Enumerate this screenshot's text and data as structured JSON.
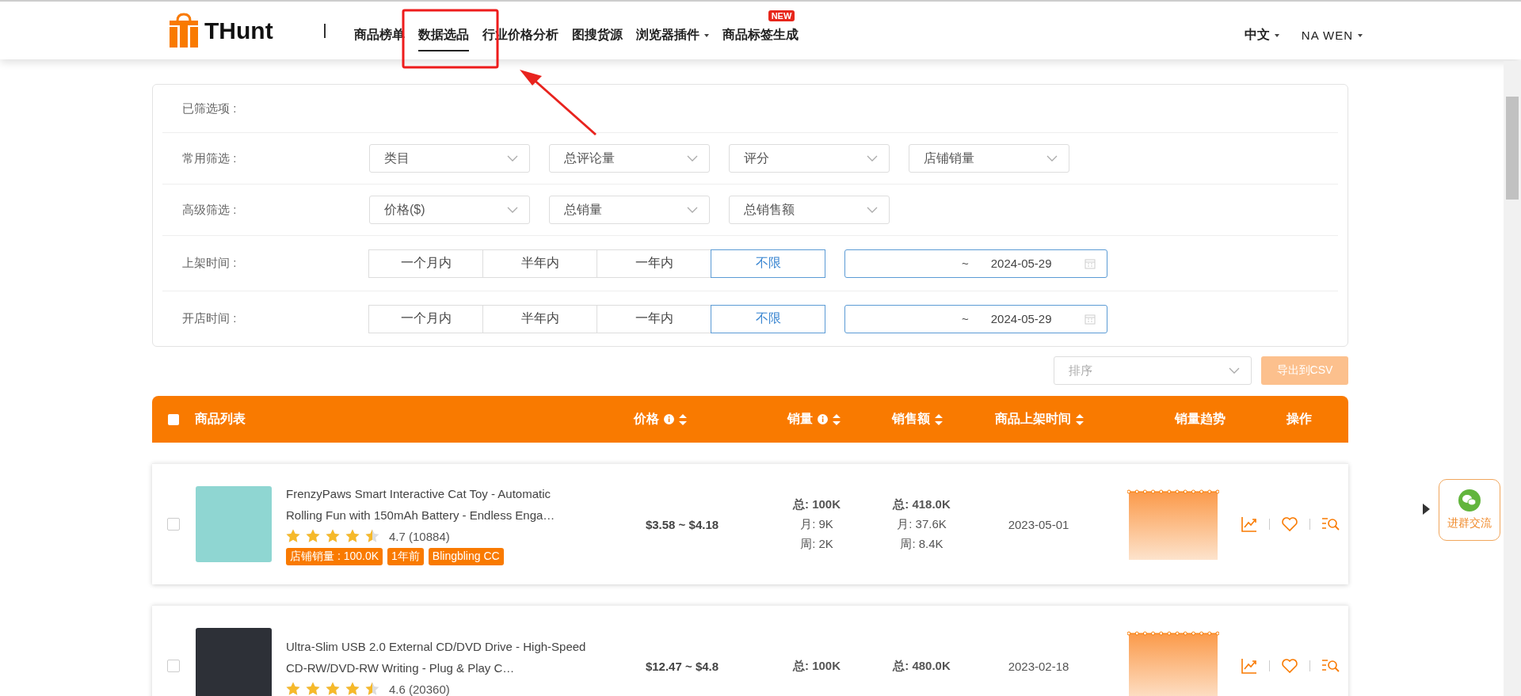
{
  "header": {
    "logo": "THunt",
    "nav": [
      {
        "label": "商品榜单",
        "selected": false,
        "caret": false
      },
      {
        "label": "数据选品",
        "selected": true,
        "caret": false
      },
      {
        "label": "行业价格分析",
        "selected": false,
        "caret": false
      },
      {
        "label": "图搜货源",
        "selected": false,
        "caret": false
      },
      {
        "label": "浏览器插件",
        "selected": false,
        "caret": true
      },
      {
        "label": "商品标签生成",
        "selected": false,
        "caret": false,
        "badge": "NEW"
      }
    ],
    "language": "中文",
    "user": "NA WEN"
  },
  "filters": {
    "chosen_label": "已筛选项 :",
    "rows": [
      {
        "kind": "selects",
        "label": "常用筛选 :",
        "options": [
          "类目",
          "总评论量",
          "评分",
          "店铺销量"
        ]
      },
      {
        "kind": "selects",
        "label": "高级筛选 :",
        "options": [
          "价格($)",
          "总销量",
          "总销售额"
        ]
      },
      {
        "kind": "period",
        "label": "上架时间 :",
        "segments": [
          {
            "label": "一个月内",
            "selected": false
          },
          {
            "label": "半年内",
            "selected": false
          },
          {
            "label": "一年内",
            "selected": false
          },
          {
            "label": "不限",
            "selected": true
          }
        ],
        "date_separator": "~",
        "date_end": "2024-05-29"
      },
      {
        "kind": "period",
        "label": "开店时间 :",
        "segments": [
          {
            "label": "一个月内",
            "selected": false
          },
          {
            "label": "半年内",
            "selected": false
          },
          {
            "label": "一年内",
            "selected": false
          },
          {
            "label": "不限",
            "selected": true
          }
        ],
        "date_separator": "~",
        "date_end": "2024-05-29"
      }
    ]
  },
  "toolbar": {
    "sort_placeholder": "排序",
    "export_button": "导出到CSV"
  },
  "table": {
    "select_all_checked": false,
    "columns": [
      {
        "label": "商品列表",
        "info": false,
        "sortable": false
      },
      {
        "label": "价格",
        "info": true,
        "sortable": true
      },
      {
        "label": "销量",
        "info": true,
        "sortable": true
      },
      {
        "label": "销售额",
        "info": false,
        "sortable": true
      },
      {
        "label": "商品上架时间",
        "info": false,
        "sortable": true
      },
      {
        "label": "销量趋势",
        "info": false,
        "sortable": false
      },
      {
        "label": "操作",
        "info": false,
        "sortable": false
      }
    ],
    "rows": [
      {
        "checked": false,
        "title": "FrenzyPaws Smart Interactive Cat Toy - Automatic Rolling Fun with 150mAh Battery - Endless Enga…",
        "stars": 4.5,
        "rating": "4.7 (10884)",
        "tags": [
          "店铺销量 : 100.0K",
          "1年前",
          "Blingbling CC"
        ],
        "price": "$3.58 ~ $4.18",
        "sales": [
          "总: 100K",
          "月: 9K",
          "周: 2K"
        ],
        "revenue": [
          "总: 418.0K",
          "月: 37.6K",
          "周: 8.4K"
        ],
        "date": "2023-05-01"
      },
      {
        "checked": false,
        "title": "Ultra-Slim USB 2.0 External CD/DVD Drive - High-Speed CD-RW/DVD-RW Writing - Plug & Play C…",
        "stars": 4.5,
        "rating": "4.6 (20360)",
        "tags": [],
        "price": "$12.47 ~ $4.8",
        "sales": [
          "总: 100K"
        ],
        "revenue": [
          "总: 480.0K"
        ],
        "date": "2023-02-18"
      }
    ]
  },
  "chat_widget": {
    "label": "进群交流"
  }
}
